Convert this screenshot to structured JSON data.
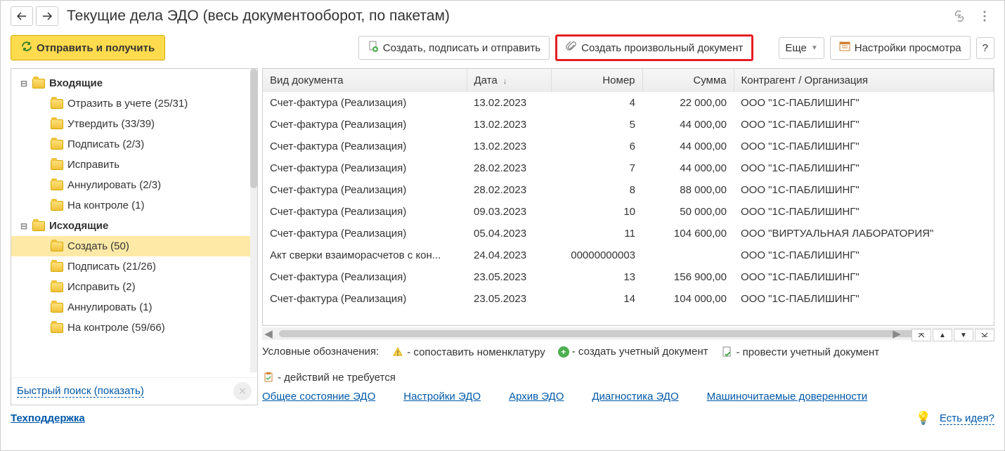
{
  "header": {
    "title": "Текущие дела ЭДО (весь документооборот, по пакетам)"
  },
  "toolbar": {
    "send_receive": "Отправить и получить",
    "create_sign_send": "Создать, подписать и отправить",
    "create_arbitrary": "Создать произвольный документ",
    "more": "Еще",
    "view_settings": "Настройки просмотра",
    "help": "?"
  },
  "tree": [
    {
      "level": 0,
      "expand": "minus",
      "label": "Входящие"
    },
    {
      "level": 1,
      "label": "Отразить в учете (25/31)"
    },
    {
      "level": 1,
      "label": "Утвердить (33/39)"
    },
    {
      "level": 1,
      "label": "Подписать (2/3)"
    },
    {
      "level": 1,
      "label": "Исправить"
    },
    {
      "level": 1,
      "label": "Аннулировать (2/3)"
    },
    {
      "level": 1,
      "label": "На контроле (1)"
    },
    {
      "level": 0,
      "expand": "minus",
      "label": "Исходящие"
    },
    {
      "level": 1,
      "label": "Создать (50)",
      "selected": true
    },
    {
      "level": 1,
      "label": "Подписать (21/26)"
    },
    {
      "level": 1,
      "label": "Исправить (2)"
    },
    {
      "level": 1,
      "label": "Аннулировать (1)"
    },
    {
      "level": 1,
      "label": "На контроле (59/66)"
    }
  ],
  "quick_search": "Быстрый поиск (показать)",
  "columns": {
    "doc_type": "Вид документа",
    "date": "Дата",
    "number": "Номер",
    "sum": "Сумма",
    "contractor": "Контрагент / Организация"
  },
  "rows": [
    {
      "doc": "Счет-фактура (Реализация)",
      "date": "13.02.2023",
      "num": "4",
      "sum": "22 000,00",
      "contr": "ООО \"1С-ПАБЛИШИНГ\""
    },
    {
      "doc": "Счет-фактура (Реализация)",
      "date": "13.02.2023",
      "num": "5",
      "sum": "44 000,00",
      "contr": "ООО \"1С-ПАБЛИШИНГ\""
    },
    {
      "doc": "Счет-фактура (Реализация)",
      "date": "13.02.2023",
      "num": "6",
      "sum": "44 000,00",
      "contr": "ООО \"1С-ПАБЛИШИНГ\""
    },
    {
      "doc": "Счет-фактура (Реализация)",
      "date": "28.02.2023",
      "num": "7",
      "sum": "44 000,00",
      "contr": "ООО \"1С-ПАБЛИШИНГ\""
    },
    {
      "doc": "Счет-фактура (Реализация)",
      "date": "28.02.2023",
      "num": "8",
      "sum": "88 000,00",
      "contr": "ООО \"1С-ПАБЛИШИНГ\""
    },
    {
      "doc": "Счет-фактура (Реализация)",
      "date": "09.03.2023",
      "num": "10",
      "sum": "50 000,00",
      "contr": "ООО \"1С-ПАБЛИШИНГ\""
    },
    {
      "doc": "Счет-фактура (Реализация)",
      "date": "05.04.2023",
      "num": "11",
      "sum": "104 600,00",
      "contr": "ООО \"ВИРТУАЛЬНАЯ ЛАБОРАТОРИЯ\""
    },
    {
      "doc": "Акт сверки взаиморасчетов с кон...",
      "date": "24.04.2023",
      "num": "00000000003",
      "sum": "",
      "contr": "ООО \"1С-ПАБЛИШИНГ\""
    },
    {
      "doc": "Счет-фактура (Реализация)",
      "date": "23.05.2023",
      "num": "13",
      "sum": "156 900,00",
      "contr": "ООО \"1С-ПАБЛИШИНГ\""
    },
    {
      "doc": "Счет-фактура (Реализация)",
      "date": "23.05.2023",
      "num": "14",
      "sum": "104 000,00",
      "contr": "ООО \"1С-ПАБЛИШИНГ\""
    }
  ],
  "legend": {
    "label": "Условные обозначения:",
    "map_nomenclature": "- сопоставить номенклатуру",
    "create_accounting": "- создать учетный документ",
    "post_accounting": "- провести учетный документ",
    "no_action": "- действий не требуется"
  },
  "links": {
    "overall_state": "Общее состояние ЭДО",
    "settings_edo": "Настройки ЭДО",
    "archive_edo": "Архив ЭДО",
    "diagnostics_edo": "Диагностика ЭДО",
    "machine_readable": "Машиночитаемые доверенности"
  },
  "footer": {
    "support": "Техподдержка",
    "idea": "Есть идея?"
  }
}
